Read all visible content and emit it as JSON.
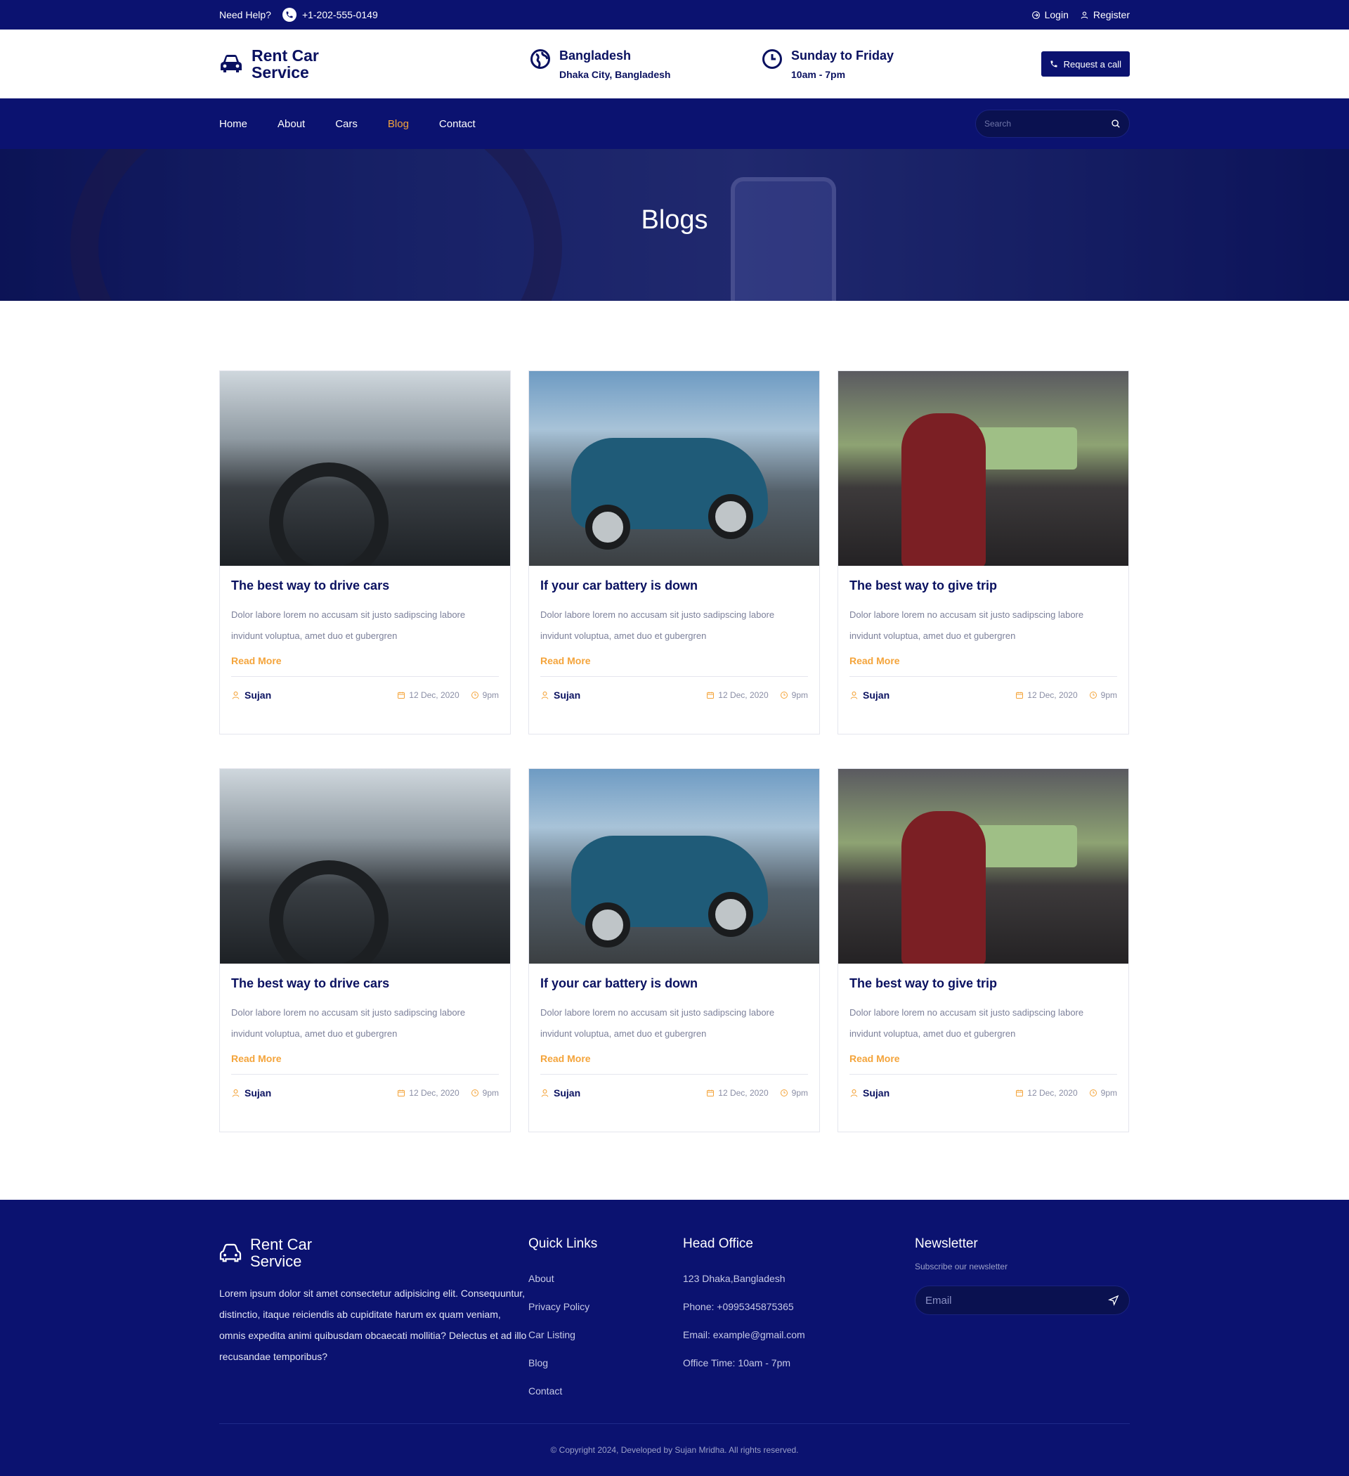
{
  "topbar": {
    "help_label": "Need Help?",
    "phone": "+1-202-555-0149",
    "login": "Login",
    "register": "Register"
  },
  "header": {
    "brand_line1": "Rent Car",
    "brand_line2": "Service",
    "location_title": "Bangladesh",
    "location_sub": "Dhaka City, Bangladesh",
    "hours_title": "Sunday to Friday",
    "hours_sub": "10am - 7pm",
    "request_button": "Request a call"
  },
  "nav": {
    "items": [
      {
        "label": "Home"
      },
      {
        "label": "About"
      },
      {
        "label": "Cars"
      },
      {
        "label": "Blog",
        "active": true
      },
      {
        "label": "Contact"
      }
    ],
    "search_placeholder": "Search"
  },
  "hero": {
    "title": "Blogs"
  },
  "posts": [
    {
      "title": "The best way to drive cars",
      "excerpt": "Dolor labore lorem no accusam sit justo sadipscing labore invidunt voluptua, amet duo et gubergren",
      "read_more": "Read More",
      "author": "Sujan",
      "date": "12 Dec, 2020",
      "time": "9pm",
      "image": "drive"
    },
    {
      "title": "If your car battery is down",
      "excerpt": "Dolor labore lorem no accusam sit justo sadipscing labore invidunt voluptua, amet duo et gubergren",
      "read_more": "Read More",
      "author": "Sujan",
      "date": "12 Dec, 2020",
      "time": "9pm",
      "image": "car"
    },
    {
      "title": "The best way to give trip",
      "excerpt": "Dolor labore lorem no accusam sit justo sadipscing labore invidunt voluptua, amet duo et gubergren",
      "read_more": "Read More",
      "author": "Sujan",
      "date": "12 Dec, 2020",
      "time": "9pm",
      "image": "trip"
    },
    {
      "title": "The best way to drive cars",
      "excerpt": "Dolor labore lorem no accusam sit justo sadipscing labore invidunt voluptua, amet duo et gubergren",
      "read_more": "Read More",
      "author": "Sujan",
      "date": "12 Dec, 2020",
      "time": "9pm",
      "image": "drive"
    },
    {
      "title": "If your car battery is down",
      "excerpt": "Dolor labore lorem no accusam sit justo sadipscing labore invidunt voluptua, amet duo et gubergren",
      "read_more": "Read More",
      "author": "Sujan",
      "date": "12 Dec, 2020",
      "time": "9pm",
      "image": "car"
    },
    {
      "title": "The best way to give trip",
      "excerpt": "Dolor labore lorem no accusam sit justo sadipscing labore invidunt voluptua, amet duo et gubergren",
      "read_more": "Read More",
      "author": "Sujan",
      "date": "12 Dec, 2020",
      "time": "9pm",
      "image": "trip"
    }
  ],
  "footer": {
    "brand_line1": "Rent Car",
    "brand_line2": "Service",
    "description": "Lorem ipsum dolor sit amet consectetur adipisicing elit. Consequuntur, distinctio, itaque reiciendis ab cupiditate harum ex quam veniam, omnis expedita animi quibusdam obcaecati mollitia? Delectus et ad illo recusandae temporibus?",
    "quick_links_title": "Quick Links",
    "quick_links": [
      "About",
      "Privacy Policy",
      "Car Listing",
      "Blog",
      "Contact"
    ],
    "head_office_title": "Head Office",
    "office_lines": [
      "123 Dhaka,Bangladesh",
      "Phone: +0995345875365",
      "Email: example@gmail.com",
      "Office Time: 10am - 7pm"
    ],
    "newsletter_title": "Newsletter",
    "newsletter_sub": "Subscribe our newsletter",
    "email_placeholder": "Email",
    "copyright": "© Copyright 2024, Developed by Sujan Mridha. All rights reserved."
  },
  "colors": {
    "primary": "#0b1270",
    "accent": "#f4a43b",
    "text_dark": "#0a1160"
  },
  "icons": {
    "phone": "phone-icon",
    "login": "login-icon",
    "register": "user-icon",
    "car": "car-icon",
    "globe": "globe-icon",
    "clock": "clock-icon",
    "search": "search-icon",
    "calendar": "calendar-icon",
    "send": "send-icon"
  }
}
